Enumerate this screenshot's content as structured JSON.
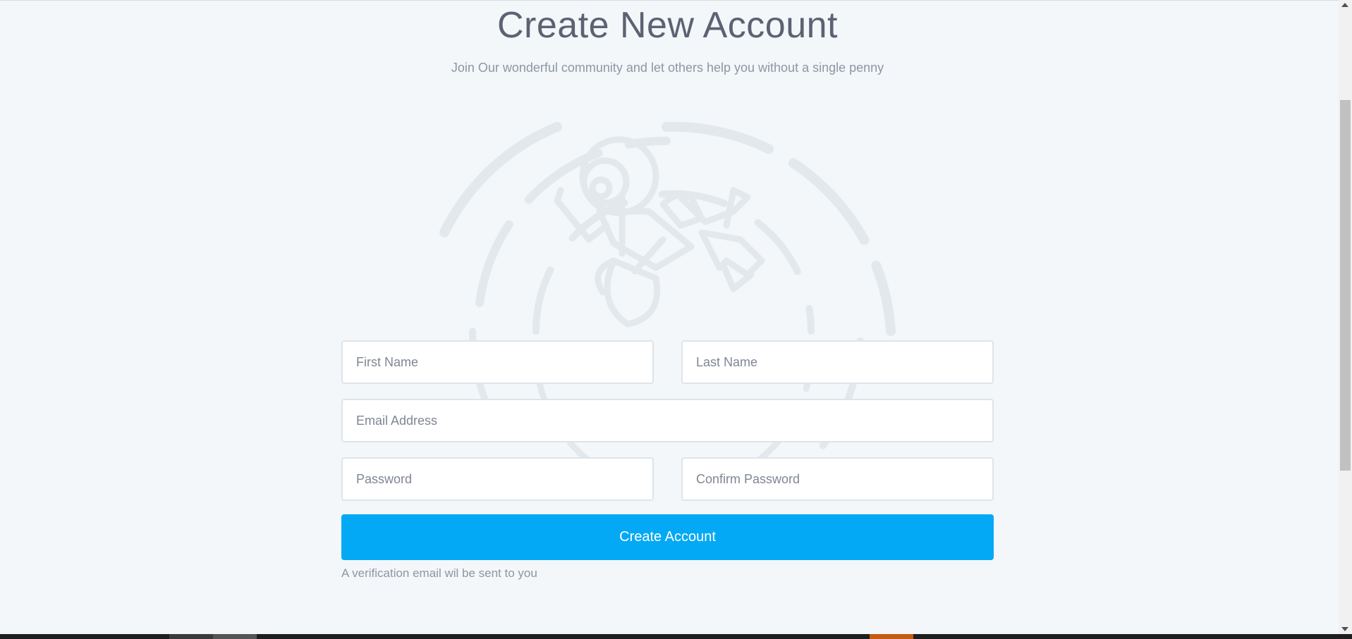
{
  "header": {
    "title": "Create New Account",
    "subtitle": "Join Our wonderful community and let others help you without a single penny"
  },
  "illustration": {
    "icon": "astronaut-icon"
  },
  "form": {
    "first_name": {
      "placeholder": "First Name",
      "value": ""
    },
    "last_name": {
      "placeholder": "Last Name",
      "value": ""
    },
    "email": {
      "placeholder": "Email Address",
      "value": ""
    },
    "password": {
      "placeholder": "Password",
      "value": ""
    },
    "confirm_password": {
      "placeholder": "Confirm Password",
      "value": ""
    },
    "submit_label": "Create Account",
    "note": "A verification email wil be sent to you"
  },
  "colors": {
    "background": "#f3f7fa",
    "accent": "#03a9f4",
    "title": "#5c6272",
    "muted": "#8f96a3",
    "input_border": "#dde4ea",
    "illustration": "#e3e8ed"
  }
}
